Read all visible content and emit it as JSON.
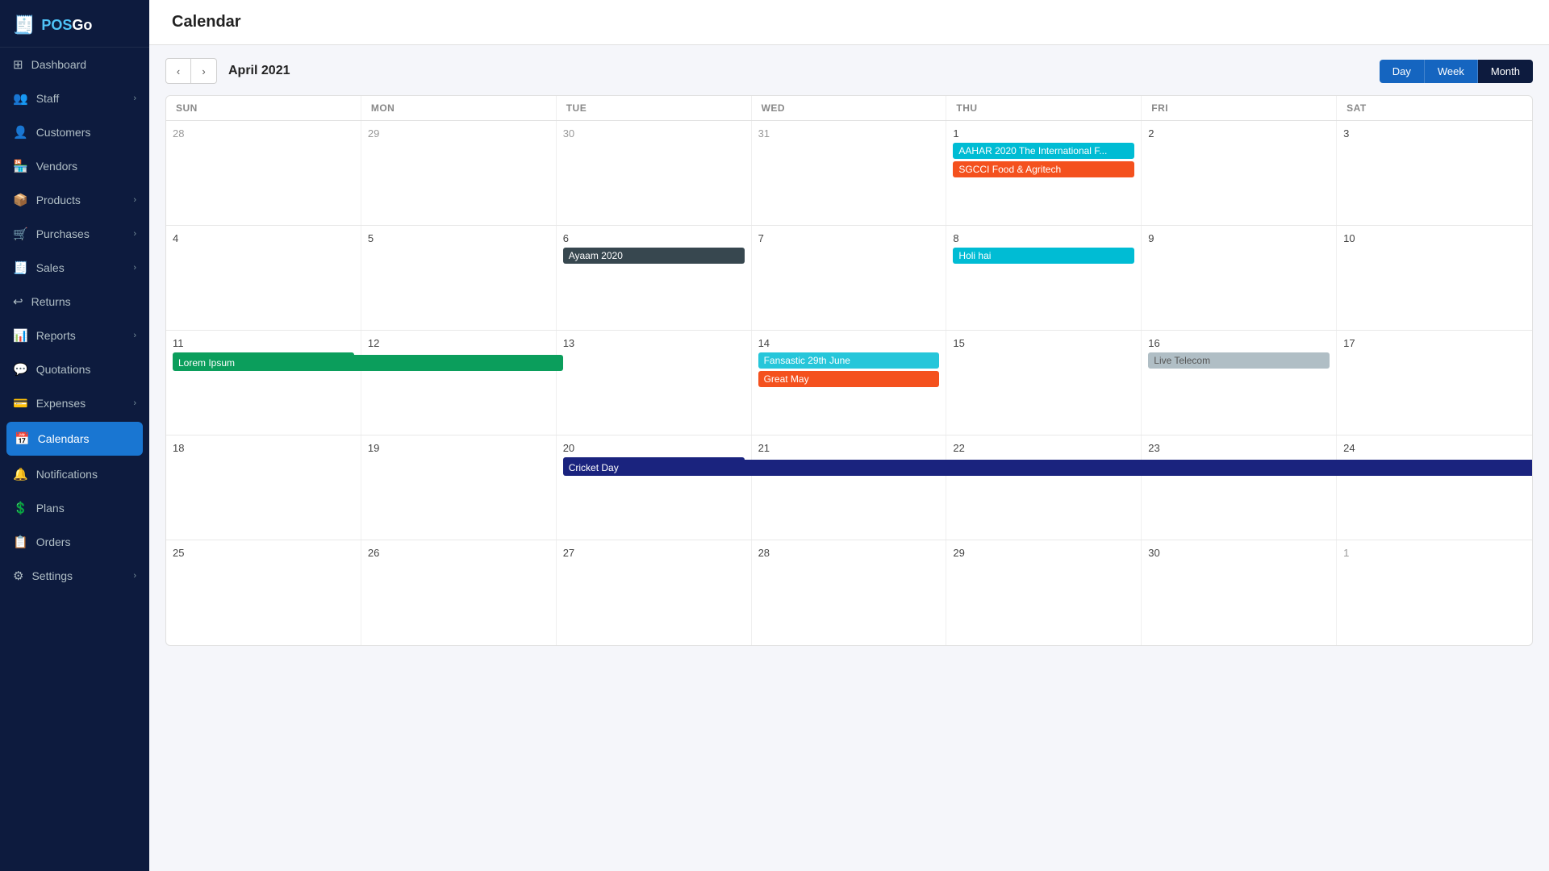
{
  "app": {
    "logo_text": "POSGo",
    "logo_icon": "🧾"
  },
  "sidebar": {
    "items": [
      {
        "id": "dashboard",
        "label": "Dashboard",
        "icon": "⊞",
        "has_sub": false
      },
      {
        "id": "staff",
        "label": "Staff",
        "icon": "👥",
        "has_sub": true
      },
      {
        "id": "customers",
        "label": "Customers",
        "icon": "👤",
        "has_sub": false
      },
      {
        "id": "vendors",
        "label": "Vendors",
        "icon": "🏪",
        "has_sub": false
      },
      {
        "id": "products",
        "label": "Products",
        "icon": "📦",
        "has_sub": true
      },
      {
        "id": "purchases",
        "label": "Purchases",
        "icon": "🛒",
        "has_sub": true
      },
      {
        "id": "sales",
        "label": "Sales",
        "icon": "🧾",
        "has_sub": true
      },
      {
        "id": "returns",
        "label": "Returns",
        "icon": "↩",
        "has_sub": false
      },
      {
        "id": "reports",
        "label": "Reports",
        "icon": "📊",
        "has_sub": true
      },
      {
        "id": "quotations",
        "label": "Quotations",
        "icon": "💬",
        "has_sub": false
      },
      {
        "id": "expenses",
        "label": "Expenses",
        "icon": "💳",
        "has_sub": true
      },
      {
        "id": "calendars",
        "label": "Calendars",
        "icon": "📅",
        "has_sub": false,
        "active": true
      },
      {
        "id": "notifications",
        "label": "Notifications",
        "icon": "🔔",
        "has_sub": false
      },
      {
        "id": "plans",
        "label": "Plans",
        "icon": "💲",
        "has_sub": false
      },
      {
        "id": "orders",
        "label": "Orders",
        "icon": "📋",
        "has_sub": false
      },
      {
        "id": "settings",
        "label": "Settings",
        "icon": "⚙",
        "has_sub": true
      }
    ]
  },
  "page": {
    "title": "Calendar"
  },
  "calendar": {
    "current_month": "April 2021",
    "nav_prev": "‹",
    "nav_next": "›",
    "view_buttons": [
      "Day",
      "Week",
      "Month"
    ],
    "active_view": "Month",
    "day_headers": [
      "SUN",
      "MON",
      "TUE",
      "WED",
      "THU",
      "FRI",
      "SAT"
    ],
    "weeks": [
      {
        "days": [
          {
            "date": "28",
            "in_month": false,
            "events": []
          },
          {
            "date": "29",
            "in_month": false,
            "events": []
          },
          {
            "date": "30",
            "in_month": false,
            "events": []
          },
          {
            "date": "31",
            "in_month": false,
            "events": []
          },
          {
            "date": "1",
            "in_month": true,
            "events": [
              {
                "label": "AAHAR 2020 The International F...",
                "color": "cyan"
              },
              {
                "label": "SGCCI Food & Agritech",
                "color": "orange"
              }
            ]
          },
          {
            "date": "2",
            "in_month": true,
            "events": []
          },
          {
            "date": "3",
            "in_month": true,
            "events": []
          }
        ]
      },
      {
        "days": [
          {
            "date": "4",
            "in_month": true,
            "events": []
          },
          {
            "date": "5",
            "in_month": true,
            "events": []
          },
          {
            "date": "6",
            "in_month": true,
            "events": [
              {
                "label": "Ayaam 2020",
                "color": "blue"
              }
            ]
          },
          {
            "date": "7",
            "in_month": true,
            "events": []
          },
          {
            "date": "8",
            "in_month": true,
            "events": [
              {
                "label": "Holi hai",
                "color": "cyan"
              }
            ]
          },
          {
            "date": "9",
            "in_month": true,
            "events": []
          },
          {
            "date": "10",
            "in_month": true,
            "events": []
          }
        ]
      },
      {
        "days": [
          {
            "date": "11",
            "in_month": true,
            "events": [
              {
                "label": "Lorem Ipsum",
                "color": "green",
                "span": 2
              }
            ]
          },
          {
            "date": "12",
            "in_month": true,
            "events": []
          },
          {
            "date": "13",
            "in_month": true,
            "events": []
          },
          {
            "date": "14",
            "in_month": true,
            "events": [
              {
                "label": "Fansastic 29th June",
                "color": "teal"
              },
              {
                "label": "Great May",
                "color": "red"
              }
            ]
          },
          {
            "date": "15",
            "in_month": true,
            "events": []
          },
          {
            "date": "16",
            "in_month": true,
            "events": [
              {
                "label": "Live Telecom",
                "color": "gray"
              }
            ]
          },
          {
            "date": "17",
            "in_month": true,
            "events": []
          }
        ]
      },
      {
        "days": [
          {
            "date": "18",
            "in_month": true,
            "events": []
          },
          {
            "date": "19",
            "in_month": true,
            "events": []
          },
          {
            "date": "20",
            "in_month": true,
            "events": [
              {
                "label": "Cricket Day",
                "color": "darkblue",
                "span": 7
              }
            ]
          },
          {
            "date": "21",
            "in_month": true,
            "events": []
          },
          {
            "date": "22",
            "in_month": true,
            "events": []
          },
          {
            "date": "23",
            "in_month": true,
            "events": []
          },
          {
            "date": "24",
            "in_month": true,
            "events": []
          }
        ]
      },
      {
        "days": [
          {
            "date": "25",
            "in_month": true,
            "events": []
          },
          {
            "date": "26",
            "in_month": true,
            "events": []
          },
          {
            "date": "27",
            "in_month": true,
            "events": []
          },
          {
            "date": "28",
            "in_month": true,
            "events": []
          },
          {
            "date": "29",
            "in_month": true,
            "events": []
          },
          {
            "date": "30",
            "in_month": true,
            "events": []
          },
          {
            "date": "1",
            "in_month": false,
            "events": []
          }
        ]
      }
    ]
  }
}
